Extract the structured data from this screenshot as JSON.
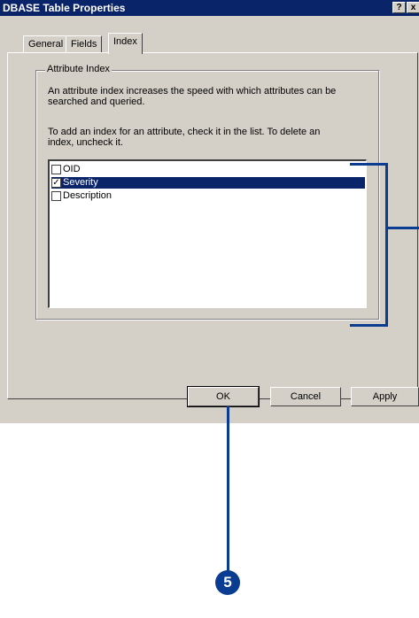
{
  "window": {
    "title": "DBASE Table Properties",
    "help_glyph": "?",
    "close_glyph": "x"
  },
  "tabs": [
    {
      "label": "General"
    },
    {
      "label": "Fields"
    },
    {
      "label": "Index"
    }
  ],
  "group": {
    "label": "Attribute Index",
    "desc_line1": "An attribute index increases the speed with which attributes can be",
    "desc_line2": "searched and queried.",
    "instr_line1": "To add an index for an attribute, check it in the list.  To delete an",
    "instr_line2": "index, uncheck it."
  },
  "fields": [
    {
      "label": "OID",
      "checked": false
    },
    {
      "label": "Severity",
      "checked": true
    },
    {
      "label": "Description",
      "checked": false
    }
  ],
  "buttons": {
    "ok": "OK",
    "cancel": "Cancel",
    "apply": "Apply"
  },
  "callout": {
    "step": "5"
  },
  "colors": {
    "title_bar": "#0a246a",
    "selection": "#0a246a",
    "callout": "#0a3d91",
    "dialog": "#d4d0c8"
  }
}
